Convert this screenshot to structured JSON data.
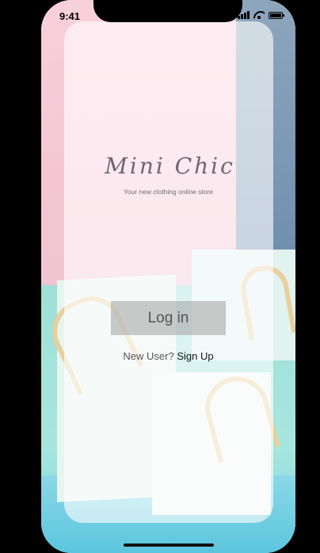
{
  "status_bar": {
    "time": "9:41"
  },
  "app": {
    "title": "Mini Chic",
    "subtitle": "Your new clothing online store"
  },
  "auth": {
    "login_label": "Log in",
    "signup_prefix": "New User?",
    "signup_link": "Sign Up"
  },
  "colors": {
    "title_text": "#6e6570",
    "button_bg": "#a0a0a0",
    "background_pink": "#f6cbd8",
    "background_mint": "#a6e6de"
  },
  "icons": [
    "signal-icon",
    "wifi-icon",
    "battery-icon"
  ]
}
